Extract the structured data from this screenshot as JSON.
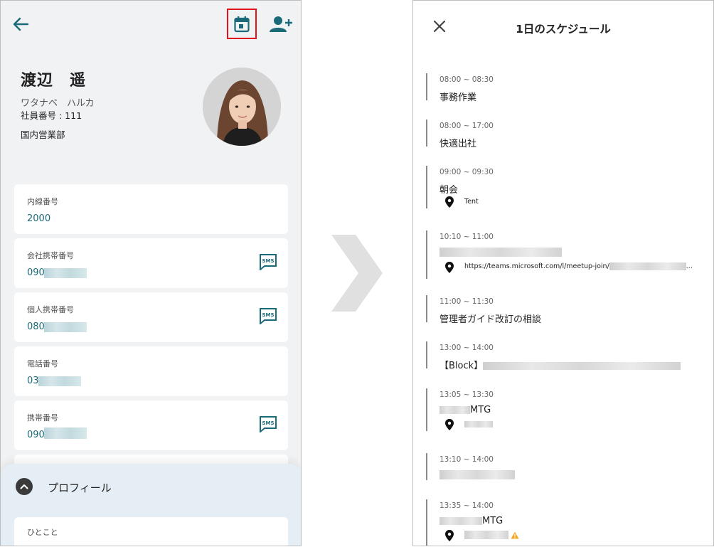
{
  "left": {
    "person": {
      "name": "渡辺　遥",
      "kana": "ワタナベ　ハルカ",
      "employee_number": "社員番号 : 111",
      "department": "国内営業部"
    },
    "contacts": [
      {
        "label": "内線番号",
        "value": "2000"
      },
      {
        "label": "会社携帯番号",
        "value": "090"
      },
      {
        "label": "個人携帯番号",
        "value": "080"
      },
      {
        "label": "電話番号",
        "value": "03"
      },
      {
        "label": "携帯番号",
        "value": "090"
      }
    ],
    "profile_section": {
      "title": "プロフィール",
      "hitokoto_label": "ひとこと"
    },
    "icons": {
      "back": "arrow-back-icon",
      "calendar": "calendar-icon",
      "add_user": "person-add-icon",
      "sms": "sms-icon",
      "collapse": "chevron-up-icon"
    },
    "accent_color": "#1b6a7a",
    "highlight_color": "#e0141b"
  },
  "right": {
    "title": "1日のスケジュール",
    "events": [
      {
        "time": "08:00 ~ 08:30",
        "title": "事務作業"
      },
      {
        "time": "08:00 ~ 17:00",
        "title": "快適出社"
      },
      {
        "time": "09:00 ~ 09:30",
        "title": "朝会",
        "location": "Tent"
      },
      {
        "time": "10:10 ~ 11:00",
        "title": "",
        "location": "https://teams.microsoft.com/l/meetup-join/"
      },
      {
        "time": "11:00 ~ 11:30",
        "title": "管理者ガイド改訂の相談"
      },
      {
        "time": "13:00 ~ 14:00",
        "title": "【Block】"
      },
      {
        "time": "13:05 ~ 13:30",
        "title": "MTG",
        "location": ""
      },
      {
        "time": "13:10 ~ 14:00",
        "title": ""
      },
      {
        "time": "13:35 ~ 14:00",
        "title": "MTG",
        "location": ""
      }
    ],
    "icons": {
      "close": "close-icon",
      "location": "location-pin-icon",
      "warning": "warning-icon"
    }
  }
}
